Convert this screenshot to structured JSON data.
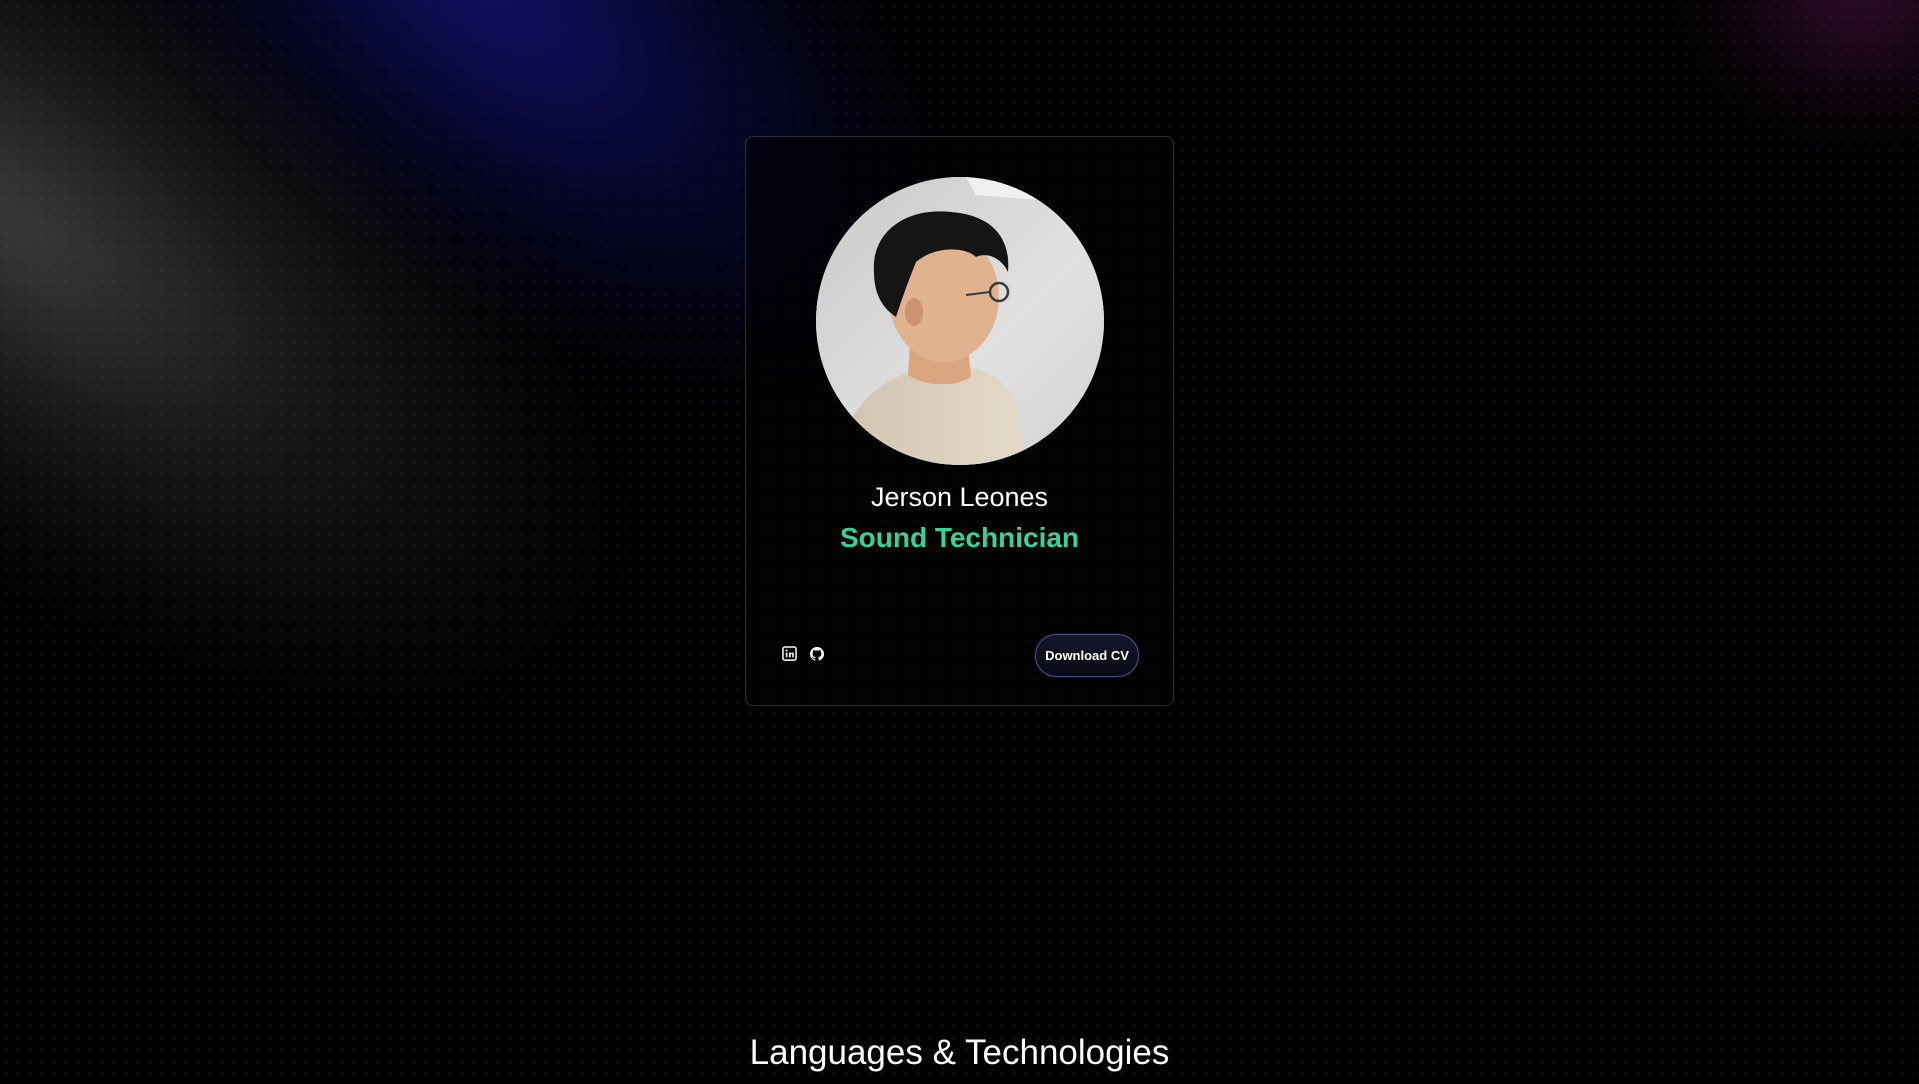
{
  "profile": {
    "name": "Jerson Leones",
    "role": "Sound Technician",
    "role_color": "#34d399",
    "photo": "profile-photo",
    "social_links": [
      {
        "icon": "linkedin-icon"
      },
      {
        "icon": "github-icon"
      }
    ],
    "download_label": "Download CV"
  },
  "sections": {
    "languages_title": "Languages & Technologies"
  },
  "theme": {
    "background": "#000000",
    "card_border": "#2b2b31",
    "button_border": "#4a4f80"
  }
}
